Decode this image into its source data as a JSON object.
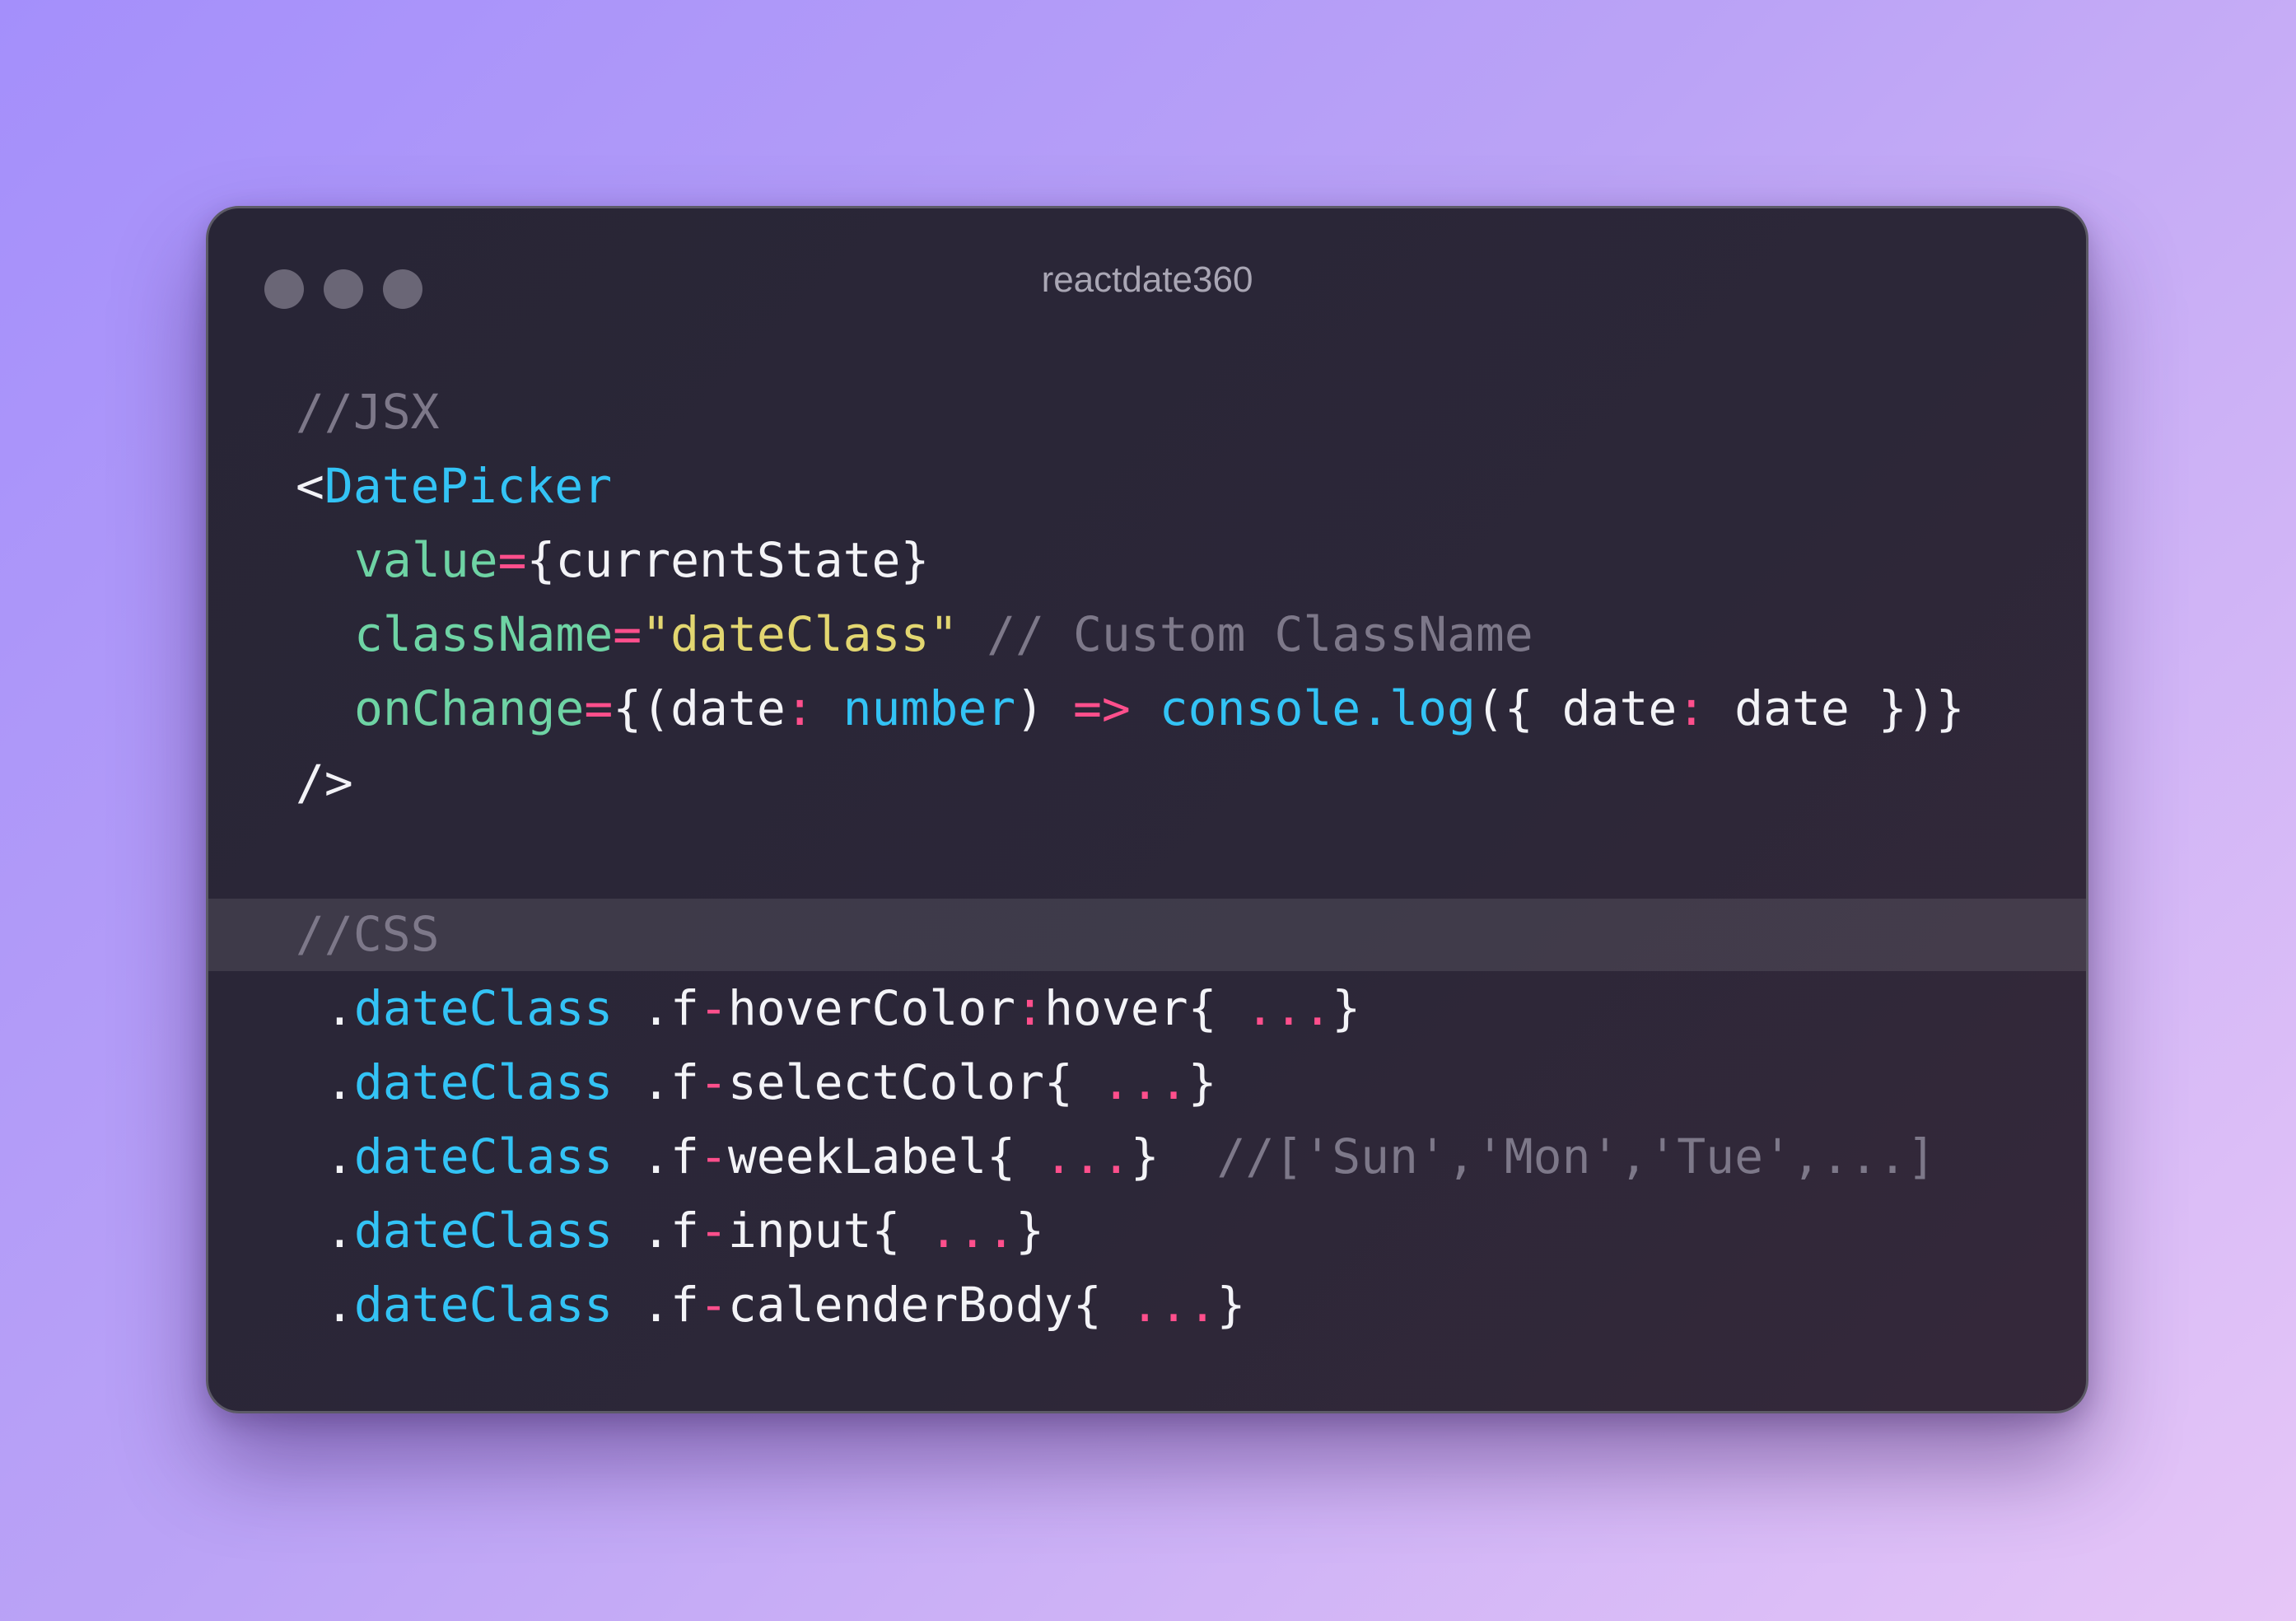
{
  "window": {
    "title": "reactdate360",
    "controls": [
      "close",
      "minimize",
      "zoom"
    ]
  },
  "code": {
    "jsx_comment": "//JSX",
    "open_tag_bracket": "<",
    "component": "DatePicker",
    "value_attr": "value",
    "eq": "=",
    "value_expr": "{currentState}",
    "classname_attr": "className",
    "classname_str": "\"dateClass\"",
    "classname_comment": "// Custom ClassName",
    "onchange_attr": "onChange",
    "onchange_open": "{(date",
    "colon": ":",
    "number_type": "number",
    "paren_close": ")",
    "arrow": "=>",
    "console_log": "console.log",
    "obj_open": "({ date",
    "obj_val": "date",
    "obj_close": "})}",
    "self_close": "/>",
    "css_comment": "//CSS",
    "dot": ".",
    "css_class": "dateClass",
    "f_prefix": ".f",
    "dash": "-",
    "rules": [
      {
        "name": "hoverColor",
        "pseudo": "hover",
        "open": "{ ",
        "dots": "...",
        "close": "}",
        "comment": ""
      },
      {
        "name": "selectColor",
        "open": "{ ",
        "dots": "...",
        "close": "}",
        "comment": ""
      },
      {
        "name": "weekLabel",
        "open": "{ ",
        "dots": "...",
        "close": "}",
        "comment": "//['Sun','Mon','Tue',...]"
      },
      {
        "name": "input",
        "open": "{ ",
        "dots": "...",
        "close": "}",
        "comment": ""
      },
      {
        "name": "calenderBody",
        "open": "{ ",
        "dots": "...",
        "close": "}",
        "comment": ""
      }
    ]
  },
  "colors": {
    "background_start": "#a48ffb",
    "background_end": "#e6c6f7",
    "window_bg": "#2a2637",
    "comment": "#7d7889",
    "tag": "#33c3f5",
    "attribute": "#6ed3a4",
    "operator": "#ff4f8c",
    "string": "#e2d670",
    "text": "#f3f3f7",
    "highlight_line": "#464152"
  }
}
